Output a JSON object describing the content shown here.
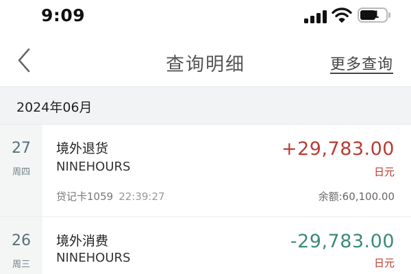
{
  "status_bar": {
    "time": "9:09",
    "battery_level": "51",
    "icons": [
      "signal-icon",
      "wifi-icon",
      "battery-icon"
    ]
  },
  "nav": {
    "title": "查询明细",
    "more_query": "更多查询",
    "back_icon": "chevron-left-icon"
  },
  "month_header": "2024年06月",
  "transactions": [
    {
      "day": "27",
      "weekday": "周四",
      "type": "境外退货",
      "merchant": "NINEHOURS",
      "card": "贷记卡1059",
      "time": "22:39:27",
      "amount": "+29,783.00",
      "currency": "日元",
      "balance_label": "余额:",
      "balance": "60,100.00"
    },
    {
      "day": "26",
      "weekday": "周三",
      "type": "境外消费",
      "merchant": "NINEHOURS",
      "amount": "-29,783.00",
      "currency": "日元"
    }
  ],
  "colors": {
    "positive_amount": "#b83c34",
    "negative_amount": "#3c8a78",
    "currency": "#c0392b",
    "month_bg": "#f1f3f4",
    "date_column_bg": "#f4f6f6"
  }
}
